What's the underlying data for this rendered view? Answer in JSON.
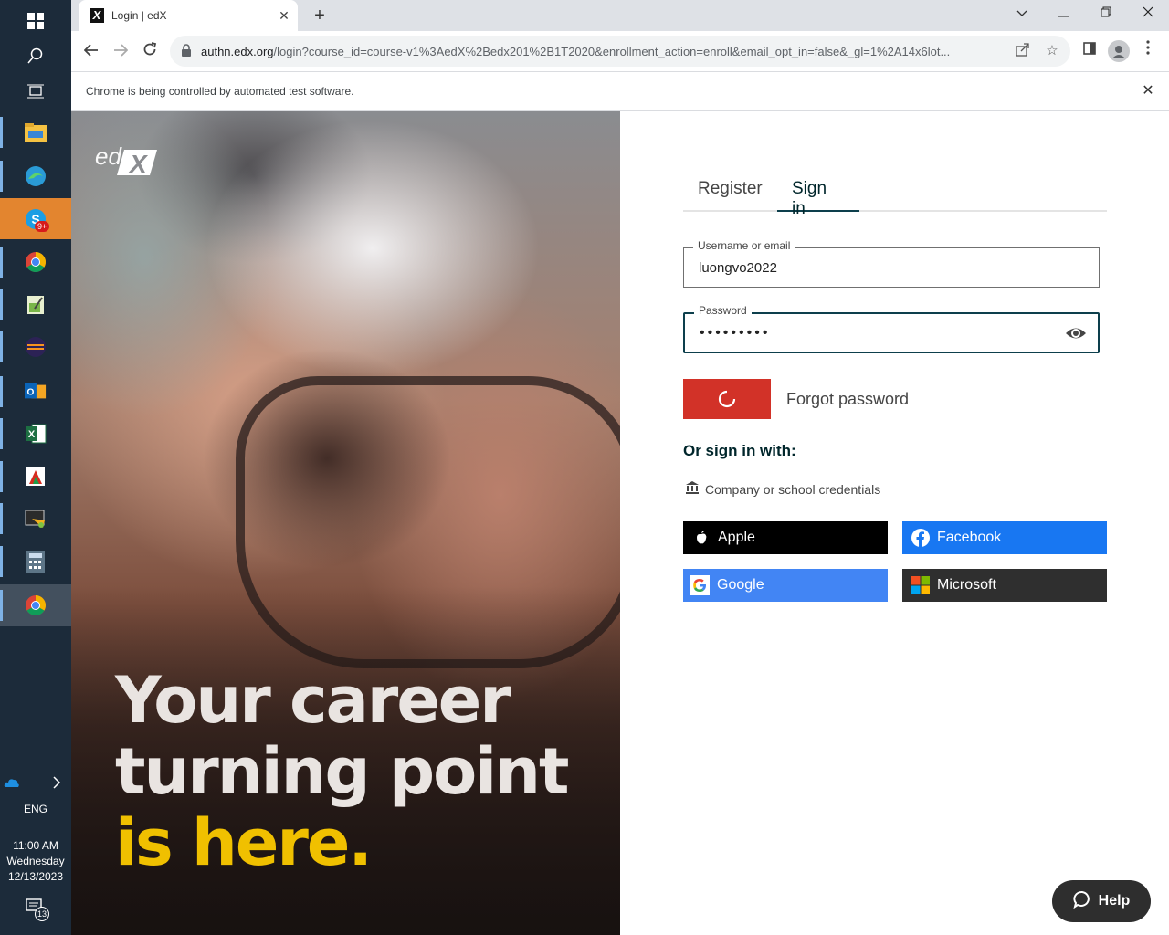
{
  "taskbar": {
    "items": [
      {
        "name": "start",
        "icon": "windows-icon"
      },
      {
        "name": "search",
        "icon": "search-icon"
      },
      {
        "name": "task-view",
        "icon": "task-view-icon"
      },
      {
        "name": "file-explorer",
        "icon": "folder-icon"
      },
      {
        "name": "edge",
        "icon": "edge-icon"
      },
      {
        "name": "skype",
        "icon": "skype-icon",
        "badge": "9+"
      },
      {
        "name": "chrome",
        "icon": "chrome-icon"
      },
      {
        "name": "notepad-plus",
        "icon": "notepad-icon"
      },
      {
        "name": "eclipse",
        "icon": "eclipse-icon"
      },
      {
        "name": "outlook",
        "icon": "outlook-icon"
      },
      {
        "name": "excel",
        "icon": "excel-icon"
      },
      {
        "name": "red-app",
        "icon": "app-icon"
      },
      {
        "name": "snipping",
        "icon": "snipping-icon"
      },
      {
        "name": "calculator",
        "icon": "calculator-icon"
      },
      {
        "name": "chrome-active",
        "icon": "chrome-icon"
      }
    ],
    "tray": {
      "language": "ENG",
      "time": "11:00 AM",
      "day": "Wednesday",
      "date": "12/13/2023",
      "notifications": "13"
    }
  },
  "browser": {
    "tab_title": "Login | edX",
    "favicon_letter": "X",
    "url_host": "authn.edx.org",
    "url_path": "/login?course_id=course-v1%3AedX%2Bedx201%2B1T2020&enrollment_action=enroll&email_opt_in=false&_gl=1%2A14x6lot...",
    "infobar_text": "Chrome is being controlled by automated test software."
  },
  "hero": {
    "logo_text": "edX",
    "line1": "Your career",
    "line2": "turning point",
    "line3": "is here.",
    "highlight_color": "#f0c000"
  },
  "login": {
    "tabs": {
      "register": "Register",
      "signin": "Sign in"
    },
    "username": {
      "label": "Username or email",
      "value": "luongvo2022"
    },
    "password": {
      "label": "Password",
      "value": "•••••••••"
    },
    "forgot_password": "Forgot password",
    "or_signin": "Or sign in with:",
    "sso_link": "Company or school credentials",
    "social": {
      "apple": "Apple",
      "facebook": "Facebook",
      "google": "Google",
      "microsoft": "Microsoft"
    },
    "submit_color": "#d23228",
    "help": "Help"
  }
}
